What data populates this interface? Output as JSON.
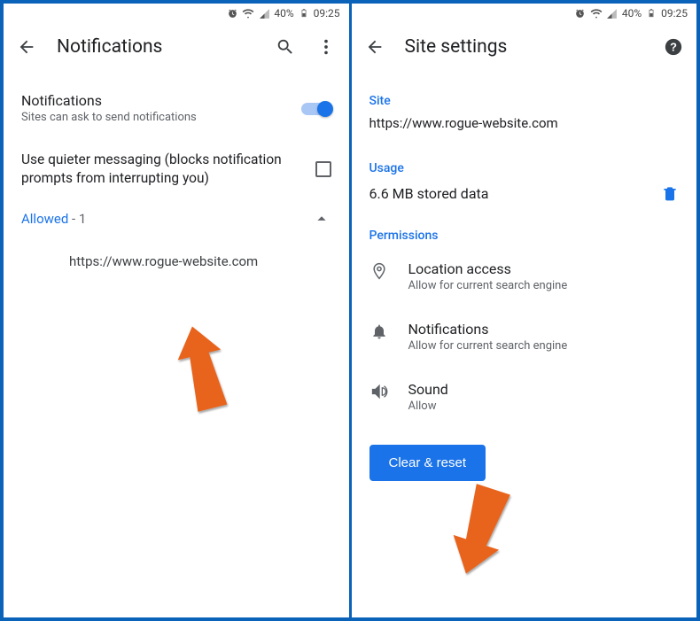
{
  "status": {
    "battery_pct": "40%",
    "time": "09:25"
  },
  "left": {
    "title": "Notifications",
    "notif_label": "Notifications",
    "notif_sub": "Sites can ask to send notifications",
    "quieter_label": "Use quieter messaging (blocks notification prompts from interrupting you)",
    "allowed_label": "Allowed",
    "allowed_count": " - 1",
    "site_url": "https://www.rogue-website.com"
  },
  "right": {
    "title": "Site settings",
    "section_site": "Site",
    "site_url": "https://www.rogue-website.com",
    "section_usage": "Usage",
    "usage_value": "6.6 MB stored data",
    "section_permissions": "Permissions",
    "perm_location_label": "Location access",
    "perm_location_sub": "Allow for current search engine",
    "perm_notif_label": "Notifications",
    "perm_notif_sub": "Allow for current search engine",
    "perm_sound_label": "Sound",
    "perm_sound_sub": "Allow",
    "clear_reset": "Clear & reset"
  }
}
